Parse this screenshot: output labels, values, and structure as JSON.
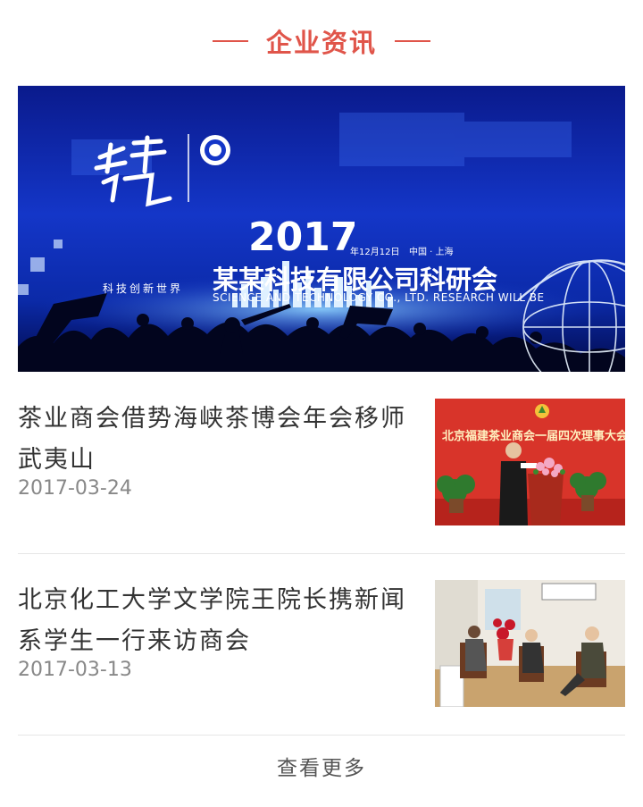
{
  "section": {
    "title": "企业资讯"
  },
  "banner": {
    "tagline": "科技创新世界",
    "year": "2017",
    "date": "年12月12日",
    "location": "中国 · 上海",
    "title": "某某科技有限公司科研会",
    "subtitle": "SCIENCE AND TECHNOLOGY CO., LTD. RESEARCH WILL BE"
  },
  "news": [
    {
      "title": "茶业商会借势海峡茶博会年会移师武夷山",
      "date": "2017-03-24",
      "thumb_banner": "北京福建茶业商会一届四次理事大会"
    },
    {
      "title": "北京化工大学文学院王院长携新闻系学生一行来访商会",
      "date": "2017-03-13"
    }
  ],
  "more_label": "查看更多",
  "colors": {
    "accent": "#e0554a"
  }
}
